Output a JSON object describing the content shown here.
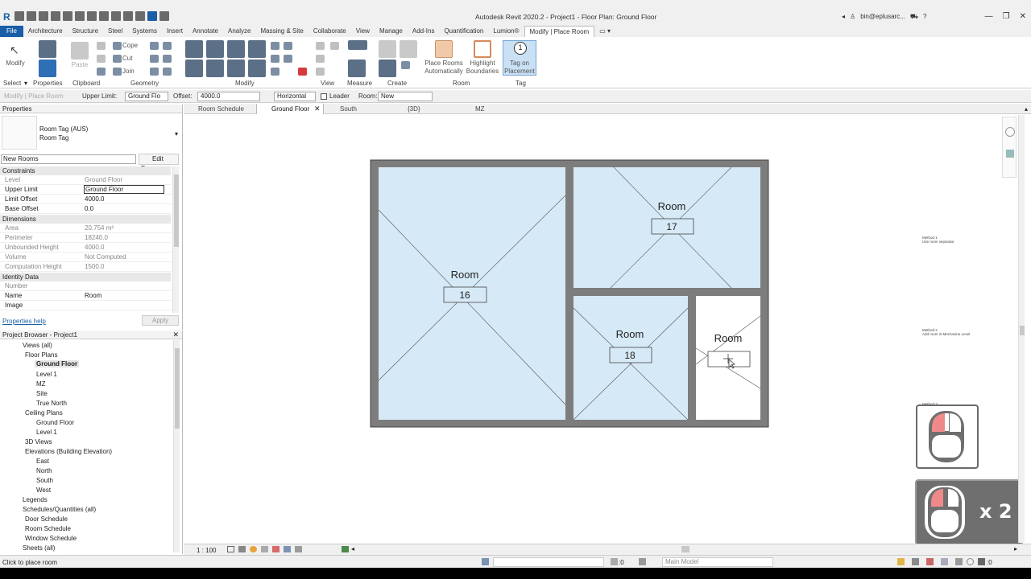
{
  "app": {
    "title": "Autodesk Revit 2020.2 - Project1 - Floor Plan: Ground Floor",
    "user": "bin@eplusarc...",
    "win_min": "—",
    "win_max": "❐",
    "win_close": "✕"
  },
  "ribbon_tabs": [
    "File",
    "Architecture",
    "Structure",
    "Steel",
    "Systems",
    "Insert",
    "Annotate",
    "Analyze",
    "Massing & Site",
    "Collaborate",
    "View",
    "Manage",
    "Add-Ins",
    "Quantification",
    "Lumion®",
    "Modify | Place Room"
  ],
  "ribbon": {
    "modify": "Modify",
    "paste": "Paste",
    "cope": "Cope",
    "cut": "Cut",
    "join": "Join",
    "place_rooms_1": "Place Rooms",
    "place_rooms_2": "Automatically",
    "highlight_1": "Highlight",
    "highlight_2": "Boundaries",
    "tag_1": "Tag on",
    "tag_2": "Placement",
    "panels": {
      "select": "Select",
      "properties": "Properties",
      "clipboard": "Clipboard",
      "geometry": "Geometry",
      "modify": "Modify",
      "view": "View",
      "measure": "Measure",
      "create": "Create",
      "room": "Room",
      "tag": "Tag"
    }
  },
  "options_bar": {
    "context": "Modify | Place Room",
    "upper_limit_label": "Upper Limit:",
    "upper_limit_value": "Ground Flo",
    "offset_label": "Offset:",
    "offset_value": "4000.0",
    "orientation": "Horizontal",
    "leader": "Leader",
    "room_label": "Room:",
    "room_value": "New"
  },
  "properties": {
    "title": "Properties",
    "type_family": "Room Tag (AUS)",
    "type_name": "Room Tag",
    "instance_filter": "New Rooms",
    "edit_type": "Edit Type",
    "groups": {
      "constraints": "Constraints",
      "dimensions": "Dimensions",
      "identity": "Identity Data"
    },
    "rows": [
      {
        "k": "Level",
        "v": "Ground Floor"
      },
      {
        "k": "Upper Limit",
        "v": "Ground Floor"
      },
      {
        "k": "Limit Offset",
        "v": "4000.0"
      },
      {
        "k": "Base Offset",
        "v": "0.0"
      },
      {
        "k": "Area",
        "v": "20.754 m²"
      },
      {
        "k": "Perimeter",
        "v": "18240.0"
      },
      {
        "k": "Unbounded Height",
        "v": "4000.0"
      },
      {
        "k": "Volume",
        "v": "Not Computed"
      },
      {
        "k": "Computation Height",
        "v": "1500.0"
      },
      {
        "k": "Number",
        "v": ""
      },
      {
        "k": "Name",
        "v": "Room"
      },
      {
        "k": "Image",
        "v": ""
      }
    ],
    "help": "Properties help",
    "apply": "Apply"
  },
  "browser": {
    "title": "Project Browser - Project1",
    "items": [
      "Views (all)",
      "Floor Plans",
      "Ground Floor",
      "Level 1",
      "MZ",
      "Site",
      "True North",
      "Ceiling Plans",
      "Ground Floor",
      "Level 1",
      "3D Views",
      "Elevations (Building Elevation)",
      "East",
      "North",
      "South",
      "West",
      "Legends",
      "Schedules/Quantities (all)",
      "Door Schedule",
      "Room Schedule",
      "Window Schedule",
      "Sheets (all)"
    ]
  },
  "view_tabs": [
    "Room Schedule",
    "Ground Floor",
    "South",
    "{3D}",
    "MZ"
  ],
  "rooms": [
    {
      "name": "Room",
      "number": "16"
    },
    {
      "name": "Room",
      "number": "17"
    },
    {
      "name": "Room",
      "number": "18"
    },
    {
      "name": "Room",
      "number": ""
    }
  ],
  "notes": {
    "method1_a": "Method 1",
    "method1_b": "Use room separator",
    "method2_a": "Method 2",
    "method2_b": "Add room in Mezzanine Level",
    "method3": "Method 3"
  },
  "mouse_overlay": {
    "double_click_label": "x 2"
  },
  "view_control": {
    "scale": "1 : 100"
  },
  "status": {
    "message": "Click to place room",
    "coord": ":0",
    "model": "Main Model",
    "filter": ":0"
  },
  "colors": {
    "room_fill": "#d6e9f6",
    "wall": "#7d7d7d",
    "accent": "#1a5ea8",
    "mouse_red": "#f08a8a"
  }
}
